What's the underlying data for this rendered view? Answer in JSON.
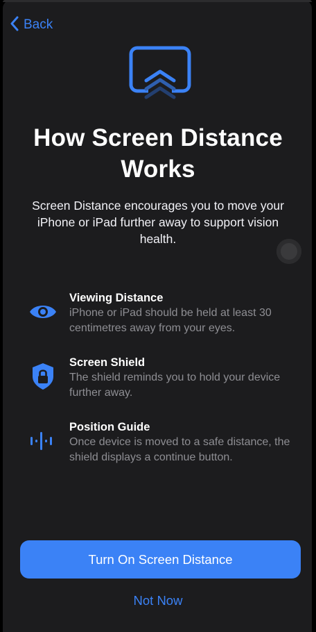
{
  "nav": {
    "back_label": "Back",
    "back_icon": "chevron-left-icon"
  },
  "header": {
    "hero_icon": "screen-distance-icon",
    "title": "How Screen Distance Works",
    "subtitle": "Screen Distance encourages you to move your iPhone or iPad further away to support vision health."
  },
  "features": [
    {
      "icon": "eye-icon",
      "title": "Viewing Distance",
      "description": "iPhone or iPad should be held at least 30 centimetres away from your eyes."
    },
    {
      "icon": "shield-lock-icon",
      "title": "Screen Shield",
      "description": "The shield reminds you to hold your device further away."
    },
    {
      "icon": "waveform-icon",
      "title": "Position Guide",
      "description": "Once device is moved to a safe distance, the shield displays a continue button."
    }
  ],
  "actions": {
    "primary_label": "Turn On Screen Distance",
    "secondary_label": "Not Now"
  },
  "colors": {
    "accent": "#3b82f6",
    "background": "#1c1c1e",
    "secondary_text": "#8e8e93"
  }
}
